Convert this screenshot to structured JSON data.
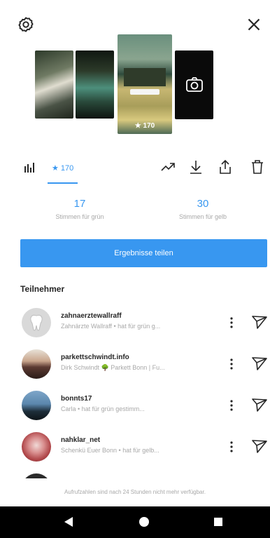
{
  "topbar": {
    "settings_icon": "gear-icon",
    "close_icon": "close-icon"
  },
  "story": {
    "caption_text": "",
    "views": "★ 170"
  },
  "toolbar": {
    "chart_icon": "bar-chart-icon",
    "views_tab": "★ 170",
    "icons": [
      "trend-icon",
      "download-icon",
      "share-icon",
      "trash-icon"
    ]
  },
  "stats": [
    {
      "value": "17",
      "label": "Stimmen für grün"
    },
    {
      "value": "30",
      "label": "Stimmen für gelb"
    }
  ],
  "results_button": "Ergebnisse teilen",
  "participants_title": "Teilnehmer",
  "participants": [
    {
      "username": "zahnaerztewallraff",
      "subtitle": "Zahnärzte Wallraff • hat für grün g...",
      "avatar_color": "#d9d9d9"
    },
    {
      "username": "parkettschwindt.info",
      "subtitle": "Dirk Schwindt 🌳 Parkett Bonn | Fu...",
      "avatar_color": "#5c3a32"
    },
    {
      "username": "bonnts17",
      "subtitle": "Carla • hat für grün gestimm...",
      "avatar_color": "#3d5a77"
    },
    {
      "username": "nahklar_net",
      "subtitle": "Schenkü Euer Bonn • hat für gelb...",
      "avatar_color": "#b0474a"
    }
  ],
  "footer_note": "Aufrufzahlen sind nach 24 Stunden nicht mehr verfügbar.",
  "colors": {
    "accent": "#3897f0",
    "text_primary": "#262626",
    "text_secondary": "#a8a8a8"
  }
}
